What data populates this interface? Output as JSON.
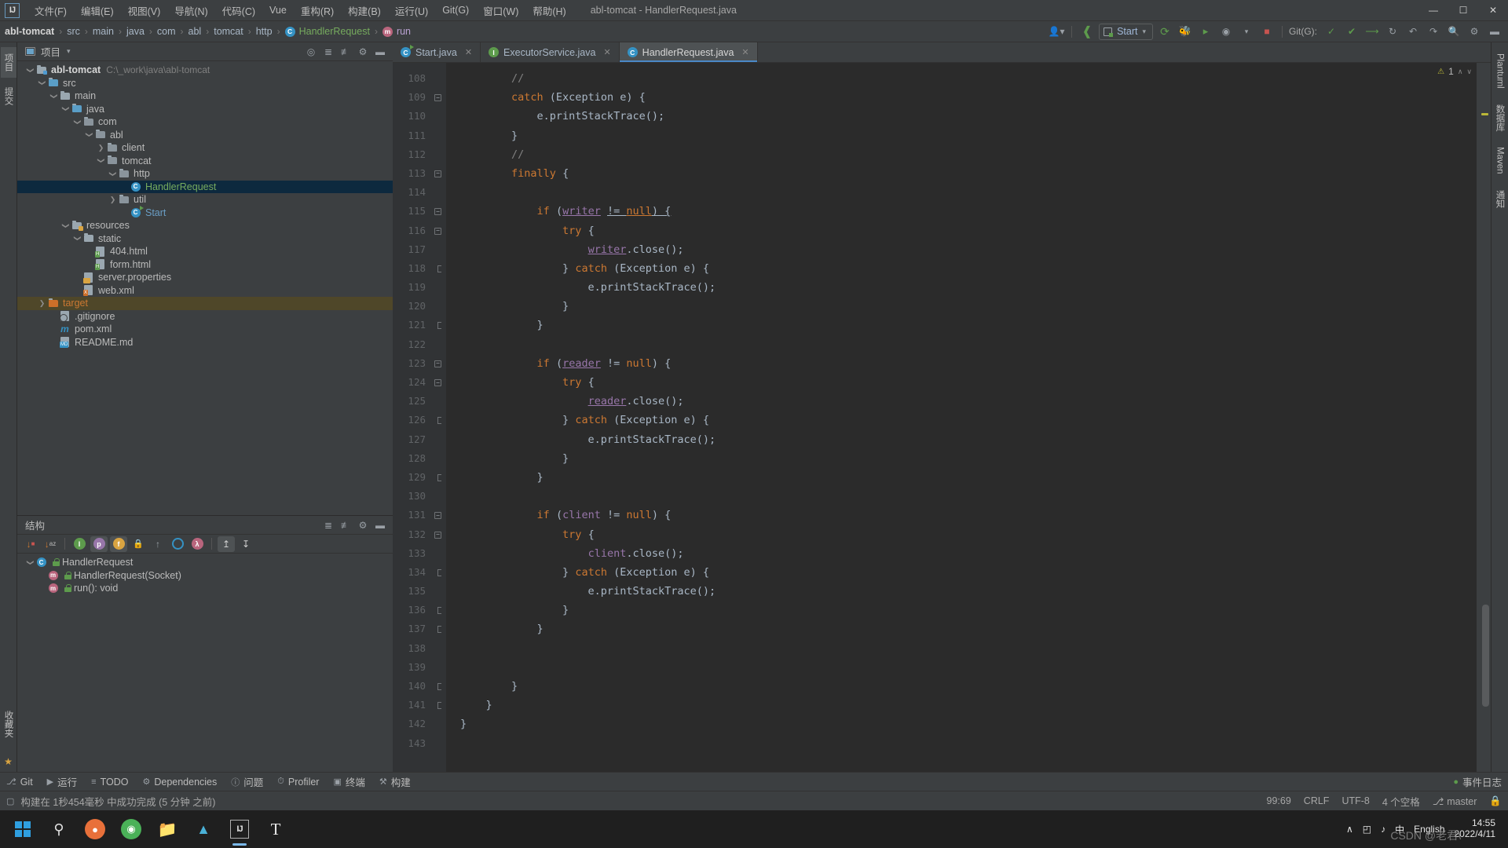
{
  "window": {
    "title": "abl-tomcat - HandlerRequest.java",
    "logo": "IJ",
    "minimize": "—",
    "maximize": "☐",
    "close": "✕"
  },
  "menu": {
    "items": [
      {
        "label": "文件(F)",
        "name": "menu-file"
      },
      {
        "label": "编辑(E)",
        "name": "menu-edit"
      },
      {
        "label": "视图(V)",
        "name": "menu-view"
      },
      {
        "label": "导航(N)",
        "name": "menu-navigate"
      },
      {
        "label": "代码(C)",
        "name": "menu-code"
      },
      {
        "label": "Vue",
        "name": "menu-vue"
      },
      {
        "label": "重构(R)",
        "name": "menu-refactor"
      },
      {
        "label": "构建(B)",
        "name": "menu-build"
      },
      {
        "label": "运行(U)",
        "name": "menu-run"
      },
      {
        "label": "Git(G)",
        "name": "menu-git"
      },
      {
        "label": "窗口(W)",
        "name": "menu-window"
      },
      {
        "label": "帮助(H)",
        "name": "menu-help"
      }
    ]
  },
  "navbar": {
    "breadcrumbs": [
      {
        "label": "abl-tomcat",
        "style": "root"
      },
      {
        "label": "src",
        "style": ""
      },
      {
        "label": "main",
        "style": ""
      },
      {
        "label": "java",
        "style": ""
      },
      {
        "label": "com",
        "style": ""
      },
      {
        "label": "abl",
        "style": ""
      },
      {
        "label": "tomcat",
        "style": ""
      },
      {
        "label": "http",
        "style": ""
      },
      {
        "label": "HandlerRequest",
        "style": "green",
        "icon": "C"
      },
      {
        "label": "run",
        "style": "purple",
        "icon": "m"
      }
    ],
    "separator": "›",
    "run_config": "Start",
    "git_label": "Git(G):",
    "dropdown_caret": "▾"
  },
  "project_panel": {
    "title": "项目",
    "caret": "▾",
    "tree": [
      {
        "label": "abl-tomcat",
        "path": "C:\\_work\\java\\abl-tomcat",
        "indent": 0,
        "arrow": "down",
        "icon": "module",
        "style": "root"
      },
      {
        "label": "src",
        "indent": 1,
        "arrow": "down",
        "icon": "folder-src",
        "style": ""
      },
      {
        "label": "main",
        "indent": 2,
        "arrow": "down",
        "icon": "folder",
        "style": ""
      },
      {
        "label": "java",
        "indent": 3,
        "arrow": "down",
        "icon": "folder-src",
        "style": ""
      },
      {
        "label": "com",
        "indent": 4,
        "arrow": "down",
        "icon": "package",
        "style": ""
      },
      {
        "label": "abl",
        "indent": 5,
        "arrow": "down",
        "icon": "package",
        "style": ""
      },
      {
        "label": "client",
        "indent": 6,
        "arrow": "right",
        "icon": "package",
        "style": ""
      },
      {
        "label": "tomcat",
        "indent": 6,
        "arrow": "down",
        "icon": "package",
        "style": ""
      },
      {
        "label": "http",
        "indent": 7,
        "arrow": "down",
        "icon": "package",
        "style": ""
      },
      {
        "label": "HandlerRequest",
        "indent": 8,
        "arrow": "none",
        "icon": "class",
        "style": "green",
        "selected": true
      },
      {
        "label": "util",
        "indent": 7,
        "arrow": "right",
        "icon": "package",
        "style": ""
      },
      {
        "label": "Start",
        "indent": 8,
        "arrow": "none",
        "icon": "class-run",
        "style": "blue"
      },
      {
        "label": "resources",
        "indent": 3,
        "arrow": "down",
        "icon": "folder-res",
        "style": ""
      },
      {
        "label": "static",
        "indent": 4,
        "arrow": "down",
        "icon": "folder",
        "style": ""
      },
      {
        "label": "404.html",
        "indent": 5,
        "arrow": "none",
        "icon": "file-html",
        "style": ""
      },
      {
        "label": "form.html",
        "indent": 5,
        "arrow": "none",
        "icon": "file-html",
        "style": ""
      },
      {
        "label": "server.properties",
        "indent": 4,
        "arrow": "none",
        "icon": "file-prop",
        "style": ""
      },
      {
        "label": "web.xml",
        "indent": 4,
        "arrow": "none",
        "icon": "file-xml",
        "style": ""
      },
      {
        "label": "target",
        "indent": 1,
        "arrow": "right",
        "icon": "folder-excluded",
        "style": "orange",
        "excluded": true
      },
      {
        "label": ".gitignore",
        "indent": 2,
        "arrow": "none",
        "icon": "file-git",
        "style": ""
      },
      {
        "label": "pom.xml",
        "indent": 2,
        "arrow": "none",
        "icon": "maven",
        "style": ""
      },
      {
        "label": "README.md",
        "indent": 2,
        "arrow": "none",
        "icon": "file-md",
        "style": ""
      }
    ]
  },
  "structure_panel": {
    "title": "结构",
    "tree": [
      {
        "label": "HandlerRequest",
        "indent": 0,
        "arrow": "down",
        "icon": "class",
        "visibility": "public"
      },
      {
        "label": "HandlerRequest(Socket)",
        "indent": 1,
        "arrow": "none",
        "icon": "method",
        "visibility": "public"
      },
      {
        "label": "run(): void",
        "indent": 1,
        "arrow": "none",
        "icon": "method",
        "visibility": "public"
      }
    ],
    "toolbar_icons": [
      {
        "name": "sort-by-visibility-icon",
        "glyph": "↓"
      },
      {
        "name": "sort-alphabetically-icon",
        "glyph": "↓"
      },
      {
        "name": "show-inherited-icon",
        "glyph": "I"
      },
      {
        "name": "show-properties-icon",
        "glyph": "p"
      },
      {
        "name": "show-fields-icon",
        "glyph": "f"
      },
      {
        "name": "show-non-public-icon",
        "glyph": "■"
      },
      {
        "name": "group-methods-icon",
        "glyph": "Y"
      },
      {
        "name": "show-anonymous-icon",
        "glyph": "O"
      },
      {
        "name": "show-lambdas-icon",
        "glyph": "λ"
      },
      {
        "name": "expand-all-icon",
        "glyph": "↥"
      },
      {
        "name": "collapse-all-icon",
        "glyph": "↧"
      }
    ]
  },
  "editor": {
    "tabs": [
      {
        "label": "Start.java",
        "icon": "C",
        "icon_color": "#3592c4",
        "active": false,
        "runnable": true
      },
      {
        "label": "ExecutorService.java",
        "icon": "I",
        "icon_color": "#5d9b4c",
        "active": false,
        "runnable": false
      },
      {
        "label": "HandlerRequest.java",
        "icon": "C",
        "icon_color": "#3592c4",
        "active": true,
        "runnable": false
      }
    ],
    "close_glyph": "✕",
    "inspection": {
      "count": "1",
      "triangle": "⚠",
      "up": "∧",
      "down": "∨"
    },
    "first_line": 108,
    "lines": [
      {
        "n": 108,
        "fold": "none",
        "html": "        <span class='cm'>//</span>"
      },
      {
        "n": 109,
        "fold": "brace",
        "html": "        <span class='kw'>catch</span> (Exception e) {"
      },
      {
        "n": 110,
        "fold": "none",
        "html": "            e.printStackTrace();"
      },
      {
        "n": 111,
        "fold": "none",
        "html": "        }"
      },
      {
        "n": 112,
        "fold": "none",
        "html": "        <span class='cm'>//</span>"
      },
      {
        "n": 113,
        "fold": "brace",
        "html": "        <span class='kw'>finally</span> {"
      },
      {
        "n": 114,
        "fold": "none",
        "html": ""
      },
      {
        "n": 115,
        "fold": "brace",
        "html": "            <span class='kw'>if</span> (<span class='fldu'>writer</span> <span class='u'>!= </span><span class='kw u'>null</span><span class='u'>) {</span>"
      },
      {
        "n": 116,
        "fold": "brace",
        "html": "                <span class='kw'>try</span> {"
      },
      {
        "n": 117,
        "fold": "none",
        "html": "                    <span class='fldu'>writer</span>.close();"
      },
      {
        "n": 118,
        "fold": "end",
        "html": "                } <span class='kw'>catch</span> (Exception e) {"
      },
      {
        "n": 119,
        "fold": "none",
        "html": "                    e.printStackTrace();"
      },
      {
        "n": 120,
        "fold": "none",
        "html": "                }"
      },
      {
        "n": 121,
        "fold": "end",
        "html": "            }"
      },
      {
        "n": 122,
        "fold": "none",
        "html": ""
      },
      {
        "n": 123,
        "fold": "brace",
        "html": "            <span class='kw'>if</span> (<span class='fldu'>reader</span> != <span class='kw'>null</span>) {"
      },
      {
        "n": 124,
        "fold": "brace",
        "html": "                <span class='kw'>try</span> {"
      },
      {
        "n": 125,
        "fold": "none",
        "html": "                    <span class='fldu'>reader</span>.close();"
      },
      {
        "n": 126,
        "fold": "end",
        "html": "                } <span class='kw'>catch</span> (Exception e) {"
      },
      {
        "n": 127,
        "fold": "none",
        "html": "                    e.printStackTrace();"
      },
      {
        "n": 128,
        "fold": "none",
        "html": "                }"
      },
      {
        "n": 129,
        "fold": "end",
        "html": "            }"
      },
      {
        "n": 130,
        "fold": "none",
        "html": ""
      },
      {
        "n": 131,
        "fold": "brace",
        "html": "            <span class='kw'>if</span> (<span class='fld'>client</span> != <span class='kw'>null</span>) {"
      },
      {
        "n": 132,
        "fold": "brace",
        "html": "                <span class='kw'>try</span> {"
      },
      {
        "n": 133,
        "fold": "none",
        "html": "                    <span class='fld'>client</span>.close();"
      },
      {
        "n": 134,
        "fold": "end",
        "html": "                } <span class='kw'>catch</span> (Exception e) {"
      },
      {
        "n": 135,
        "fold": "none",
        "html": "                    e.printStackTrace();"
      },
      {
        "n": 136,
        "fold": "end",
        "html": "                }"
      },
      {
        "n": 137,
        "fold": "end",
        "html": "            }"
      },
      {
        "n": 138,
        "fold": "none",
        "html": ""
      },
      {
        "n": 139,
        "fold": "none",
        "html": ""
      },
      {
        "n": 140,
        "fold": "end",
        "html": "        }"
      },
      {
        "n": 141,
        "fold": "end",
        "html": "    }"
      },
      {
        "n": 142,
        "fold": "none",
        "html": "}"
      },
      {
        "n": 143,
        "fold": "none",
        "html": ""
      }
    ]
  },
  "bottom_tools": [
    {
      "label": "Git",
      "name": "bottom-tab-git",
      "glyph": "⎇"
    },
    {
      "label": "运行",
      "name": "bottom-tab-run",
      "glyph": "▶"
    },
    {
      "label": "TODO",
      "name": "bottom-tab-todo",
      "glyph": "≡"
    },
    {
      "label": "Dependencies",
      "name": "bottom-tab-dependencies",
      "glyph": "⚙"
    },
    {
      "label": "问题",
      "name": "bottom-tab-problems",
      "glyph": "ⓘ"
    },
    {
      "label": "Profiler",
      "name": "bottom-tab-profiler",
      "glyph": "⏱"
    },
    {
      "label": "终端",
      "name": "bottom-tab-terminal",
      "glyph": "▣"
    },
    {
      "label": "构建",
      "name": "bottom-tab-build",
      "glyph": "⚒"
    }
  ],
  "statusbar": {
    "message": "构建在 1秒454毫秒 中成功完成 (5 分钟 之前)",
    "caret": "99:69",
    "line_separator": "CRLF",
    "encoding": "UTF-8",
    "indent": "4 个空格",
    "branch": "master",
    "event_log": "事件日志",
    "branch_icon": "⎇",
    "lock_icon": "ὑ2"
  },
  "right_strip": {
    "tabs": [
      "Plantuml",
      "数据库",
      "Maven",
      "通知"
    ]
  },
  "left_strip": {
    "tabs": [
      "项目",
      "提交",
      "收藏夹"
    ]
  },
  "taskbar": {
    "items": [
      {
        "name": "taskbar-start-button",
        "glyph": "win"
      },
      {
        "name": "taskbar-search-button",
        "glyph": "⌕"
      },
      {
        "name": "taskbar-firefox",
        "glyph": "●"
      },
      {
        "name": "taskbar-chrome",
        "glyph": "●"
      },
      {
        "name": "taskbar-explorer",
        "glyph": "▤"
      },
      {
        "name": "taskbar-app",
        "glyph": "▲"
      },
      {
        "name": "taskbar-intellij",
        "glyph": "IJ"
      },
      {
        "name": "taskbar-typora",
        "glyph": "T"
      }
    ],
    "tray": {
      "chevron": "∧",
      "volume": "♪",
      "network": "◰",
      "ime": "中",
      "ime_label": "English",
      "time": "14:55",
      "date": "2022/4/11"
    }
  },
  "watermark": "CSDN @老君\\"
}
